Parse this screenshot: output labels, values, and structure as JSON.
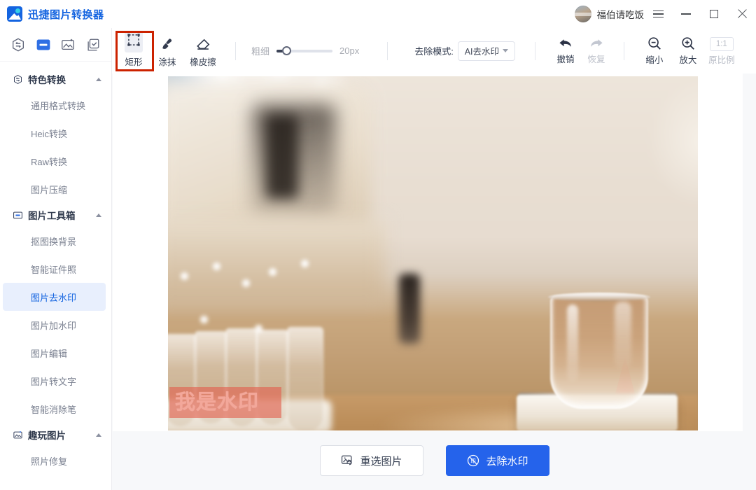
{
  "titlebar": {
    "app_name": "迅捷图片转换器",
    "username": "福伯请吃饭",
    "menu_icon": "hamburger-icon",
    "minimize_label": "",
    "maximize_label": "",
    "close_label": ""
  },
  "sidebar": {
    "top_icons": [
      {
        "name": "convert-hex-icon",
        "active": false
      },
      {
        "name": "toolbox-icon",
        "active": true
      },
      {
        "name": "image-sparkle-icon",
        "active": false
      },
      {
        "name": "batch-check-icon",
        "active": false
      }
    ],
    "groups": [
      {
        "title": "特色转换",
        "icon": "convert-hex-icon",
        "expanded": true,
        "items": [
          {
            "label": "通用格式转换",
            "active": false
          },
          {
            "label": "Heic转换",
            "active": false
          },
          {
            "label": "Raw转换",
            "active": false
          },
          {
            "label": "图片压缩",
            "active": false
          }
        ]
      },
      {
        "title": "图片工具箱",
        "icon": "toolbox-icon",
        "expanded": true,
        "items": [
          {
            "label": "抠图换背景",
            "active": false
          },
          {
            "label": "智能证件照",
            "active": false
          },
          {
            "label": "图片去水印",
            "active": true
          },
          {
            "label": "图片加水印",
            "active": false
          },
          {
            "label": "图片编辑",
            "active": false
          },
          {
            "label": "图片转文字",
            "active": false
          },
          {
            "label": "智能消除笔",
            "active": false
          }
        ]
      },
      {
        "title": "趣玩图片",
        "icon": "image-sparkle-icon",
        "expanded": true,
        "items": [
          {
            "label": "照片修复",
            "active": false
          }
        ]
      }
    ]
  },
  "toolbar": {
    "tools": [
      {
        "label": "矩形",
        "icon": "rectangle-select-icon",
        "active": true
      },
      {
        "label": "涂抹",
        "icon": "brush-icon",
        "active": false
      },
      {
        "label": "橡皮擦",
        "icon": "eraser-icon",
        "active": false
      }
    ],
    "thickness": {
      "label": "粗细",
      "value": "20px",
      "percent": 15
    },
    "mode": {
      "label": "去除模式:",
      "value": "AI去水印",
      "options": [
        "AI去水印"
      ]
    },
    "history": [
      {
        "label": "撤销",
        "icon": "undo-arrow-icon",
        "enabled": true
      },
      {
        "label": "恢复",
        "icon": "redo-arrow-icon",
        "enabled": false
      }
    ],
    "zoom": [
      {
        "label": "缩小",
        "icon": "zoom-out-icon",
        "enabled": true
      },
      {
        "label": "放大",
        "icon": "zoom-in-icon",
        "enabled": true
      }
    ],
    "ratio": {
      "badge": "1:1",
      "label": "原比例",
      "enabled": false
    }
  },
  "canvas": {
    "image_alt": "咖啡杯与玻璃杯的咖啡馆照片",
    "watermark_text": "我是水印",
    "selection_color": "#e2604e"
  },
  "actions": {
    "reselect_label": "重选图片",
    "reselect_icon": "image-refresh-icon",
    "remove_label": "去除水印",
    "remove_icon": "no-watermark-icon",
    "primary_color": "#2563eb"
  }
}
